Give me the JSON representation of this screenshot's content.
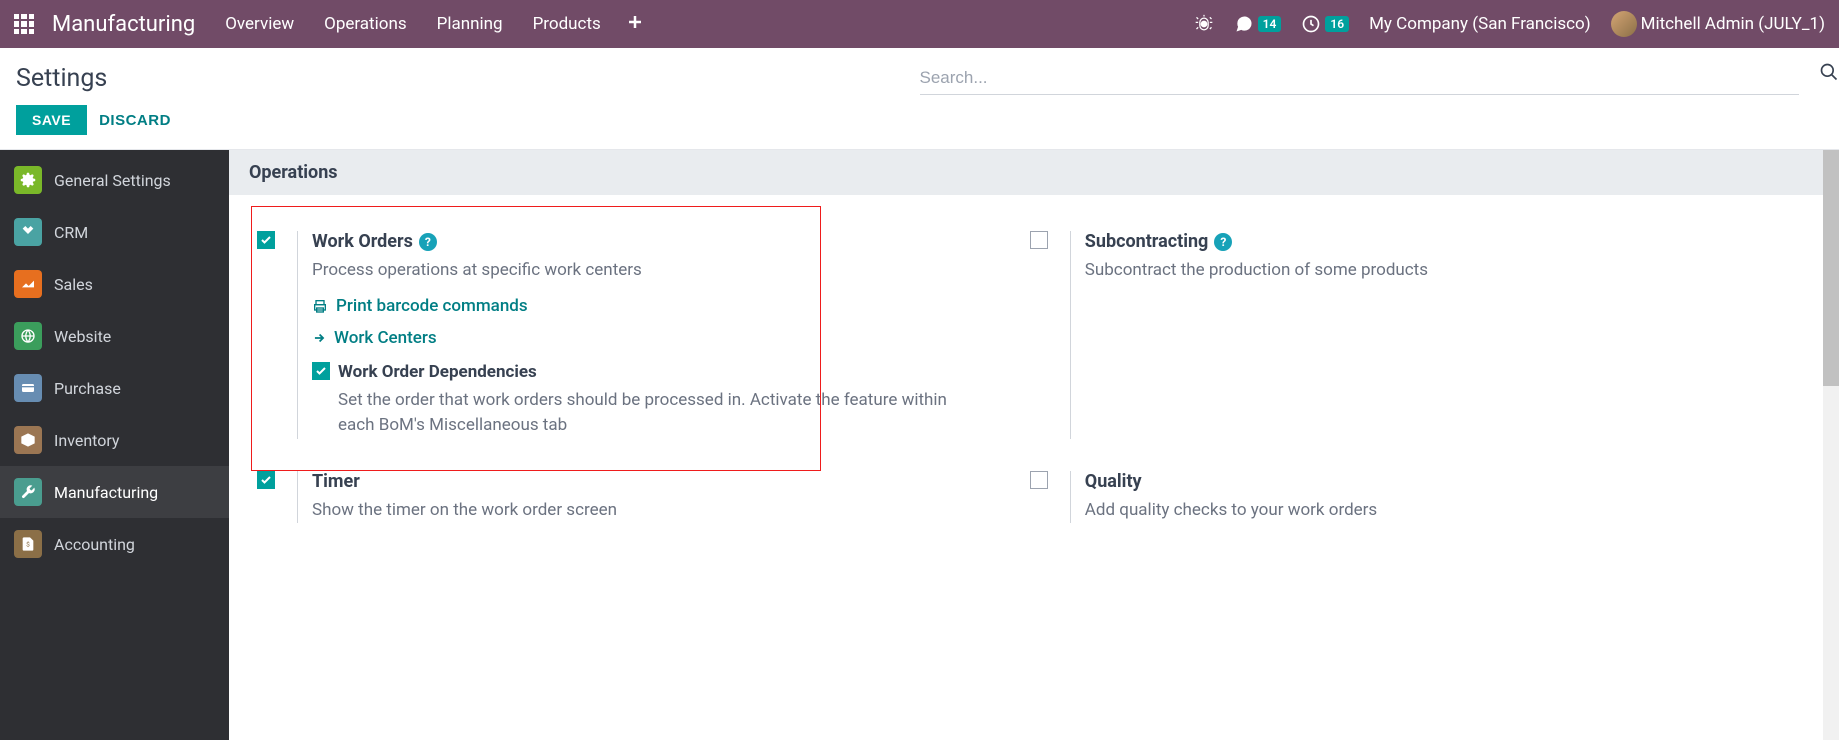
{
  "topbar": {
    "brand": "Manufacturing",
    "menu": [
      "Overview",
      "Operations",
      "Planning",
      "Products"
    ],
    "messages_badge": "14",
    "activities_badge": "16",
    "company": "My Company (San Francisco)",
    "username": "Mitchell Admin (JULY_1)"
  },
  "control_panel": {
    "title": "Settings",
    "save_label": "SAVE",
    "discard_label": "DISCARD",
    "search_placeholder": "Search..."
  },
  "sidebar": {
    "items": [
      {
        "label": "General Settings"
      },
      {
        "label": "CRM"
      },
      {
        "label": "Sales"
      },
      {
        "label": "Website"
      },
      {
        "label": "Purchase"
      },
      {
        "label": "Inventory"
      },
      {
        "label": "Manufacturing"
      },
      {
        "label": "Accounting"
      }
    ]
  },
  "content": {
    "section_title": "Operations",
    "settings": {
      "work_orders": {
        "title": "Work Orders",
        "desc": "Process operations at specific work centers",
        "link1": "Print barcode commands",
        "link2": "Work Centers",
        "sub_title": "Work Order Dependencies",
        "sub_desc": "Set the order that work orders should be processed in. Activate the feature within each BoM's Miscellaneous tab",
        "checked": true,
        "sub_checked": true
      },
      "subcontracting": {
        "title": "Subcontracting",
        "desc": "Subcontract the production of some products",
        "checked": false
      },
      "timer": {
        "title": "Timer",
        "desc": "Show the timer on the work order screen",
        "checked": true
      },
      "quality": {
        "title": "Quality",
        "desc": "Add quality checks to your work orders",
        "checked": false
      }
    }
  }
}
